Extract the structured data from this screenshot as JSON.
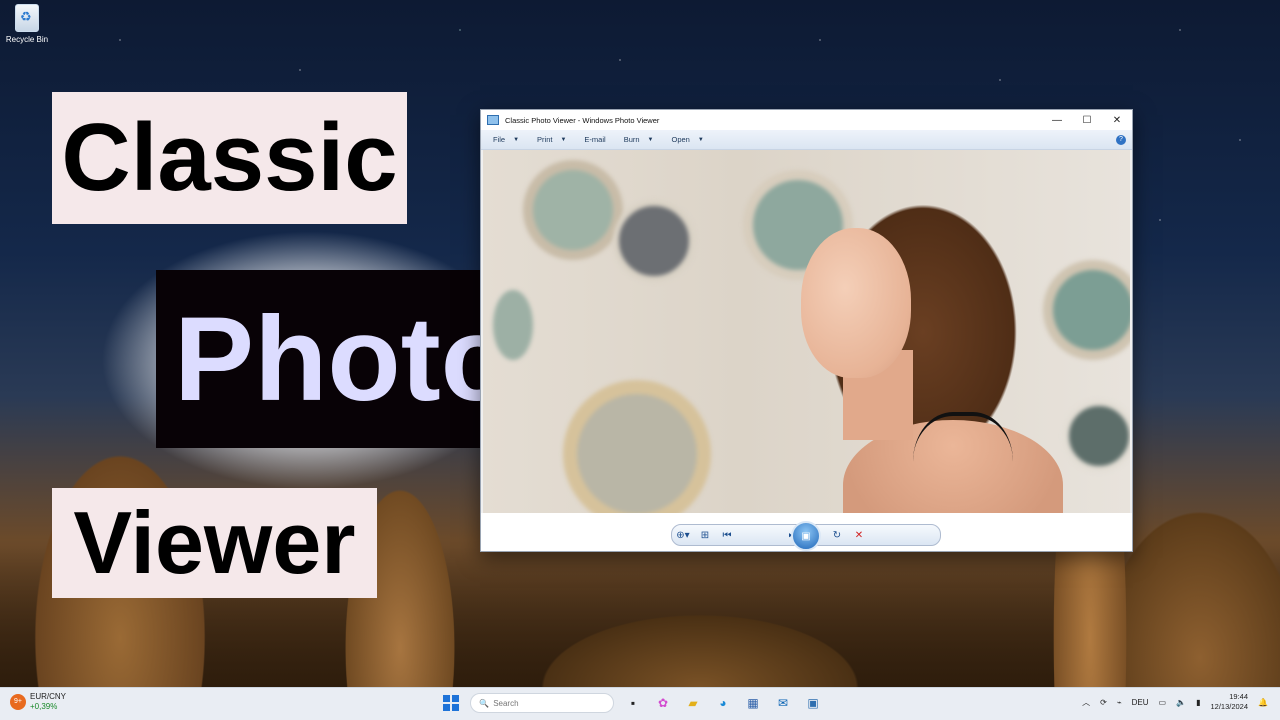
{
  "desktop": {
    "recycle_bin_label": "Recycle Bin"
  },
  "overlay": {
    "line1": "Classic",
    "line2": "Photo",
    "line3": "Viewer",
    "colors": {
      "light_box": "#f5e8ea",
      "dark_box": "#080206",
      "photo_text": "#dcdcff"
    }
  },
  "window": {
    "title": "Classic Photo Viewer - Windows Photo Viewer",
    "controls": {
      "minimize": "—",
      "maximize": "☐",
      "close": "✕"
    },
    "menu": [
      {
        "label": "File"
      },
      {
        "label": "Print"
      },
      {
        "label": "E-mail"
      },
      {
        "label": "Burn"
      },
      {
        "label": "Open"
      }
    ],
    "help": "?",
    "toolbar_icons": [
      "zoom-icon",
      "fit-icon",
      "previous-icon",
      "slideshow-icon",
      "next-icon",
      "rotate-left-icon",
      "rotate-right-icon",
      "delete-icon"
    ]
  },
  "taskbar": {
    "widget": {
      "badge": "9+",
      "name": "EUR/CNY",
      "change": "+0,39%"
    },
    "search_placeholder": "Search",
    "tray": {
      "language": "DEU",
      "time": "19:44",
      "date": "12/13/2024"
    },
    "accent": "#1e73d8"
  }
}
